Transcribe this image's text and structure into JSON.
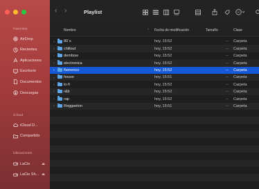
{
  "window": {
    "title": "Playlist"
  },
  "sidebar": {
    "favorites_title": "Favoritos",
    "favorites": [
      {
        "label": "AirDrop",
        "icon": "airdrop-icon"
      },
      {
        "label": "Recientes",
        "icon": "clock-icon"
      },
      {
        "label": "Aplicaciones",
        "icon": "apps-icon"
      },
      {
        "label": "Escritorio",
        "icon": "desktop-icon"
      },
      {
        "label": "Documentos",
        "icon": "document-icon"
      },
      {
        "label": "Descargas",
        "icon": "download-icon"
      }
    ],
    "icloud_title": "iCloud",
    "icloud": [
      {
        "label": "iCloud D...",
        "icon": "cloud-icon"
      },
      {
        "label": "Compartido",
        "icon": "shared-folder-icon"
      }
    ],
    "locations_title": "Ubicaciones",
    "locations": [
      {
        "label": "LaCie",
        "icon": "drive-icon"
      },
      {
        "label": "LaCie Sh...",
        "icon": "drive-icon"
      }
    ]
  },
  "columns": {
    "name": "Nombre",
    "date": "Fecha de modificación",
    "size": "Tamaño",
    "kind": "Clase"
  },
  "files": [
    {
      "name": "80´s",
      "date": "hoy, 15:52",
      "size": "--",
      "kind": "Carpeta"
    },
    {
      "name": "chillout",
      "date": "hoy, 15:52",
      "size": "--",
      "kind": "Carpeta"
    },
    {
      "name": "dembow",
      "date": "hoy, 15:52",
      "size": "--",
      "kind": "Carpeta"
    },
    {
      "name": "electronica",
      "date": "hoy, 15:52",
      "size": "--",
      "kind": "Carpeta"
    },
    {
      "name": "flamenco",
      "date": "hoy, 15:52",
      "size": "--",
      "kind": "Carpeta",
      "selected": true
    },
    {
      "name": "house",
      "date": "hoy, 15:51",
      "size": "--",
      "kind": "Carpeta"
    },
    {
      "name": "lo-fi",
      "date": "hoy, 15:52",
      "size": "--",
      "kind": "Carpeta"
    },
    {
      "name": "r&b",
      "date": "hoy, 15:52",
      "size": "--",
      "kind": "Carpeta"
    },
    {
      "name": "rap",
      "date": "hoy, 15:52",
      "size": "--",
      "kind": "Carpeta"
    },
    {
      "name": "Reggaeton",
      "date": "hoy, 15:51",
      "size": "--",
      "kind": "Carpeta"
    }
  ],
  "colors": {
    "selection": "#1659d6",
    "folder": "#5fa6e6",
    "sidebar": "#b84a48"
  }
}
